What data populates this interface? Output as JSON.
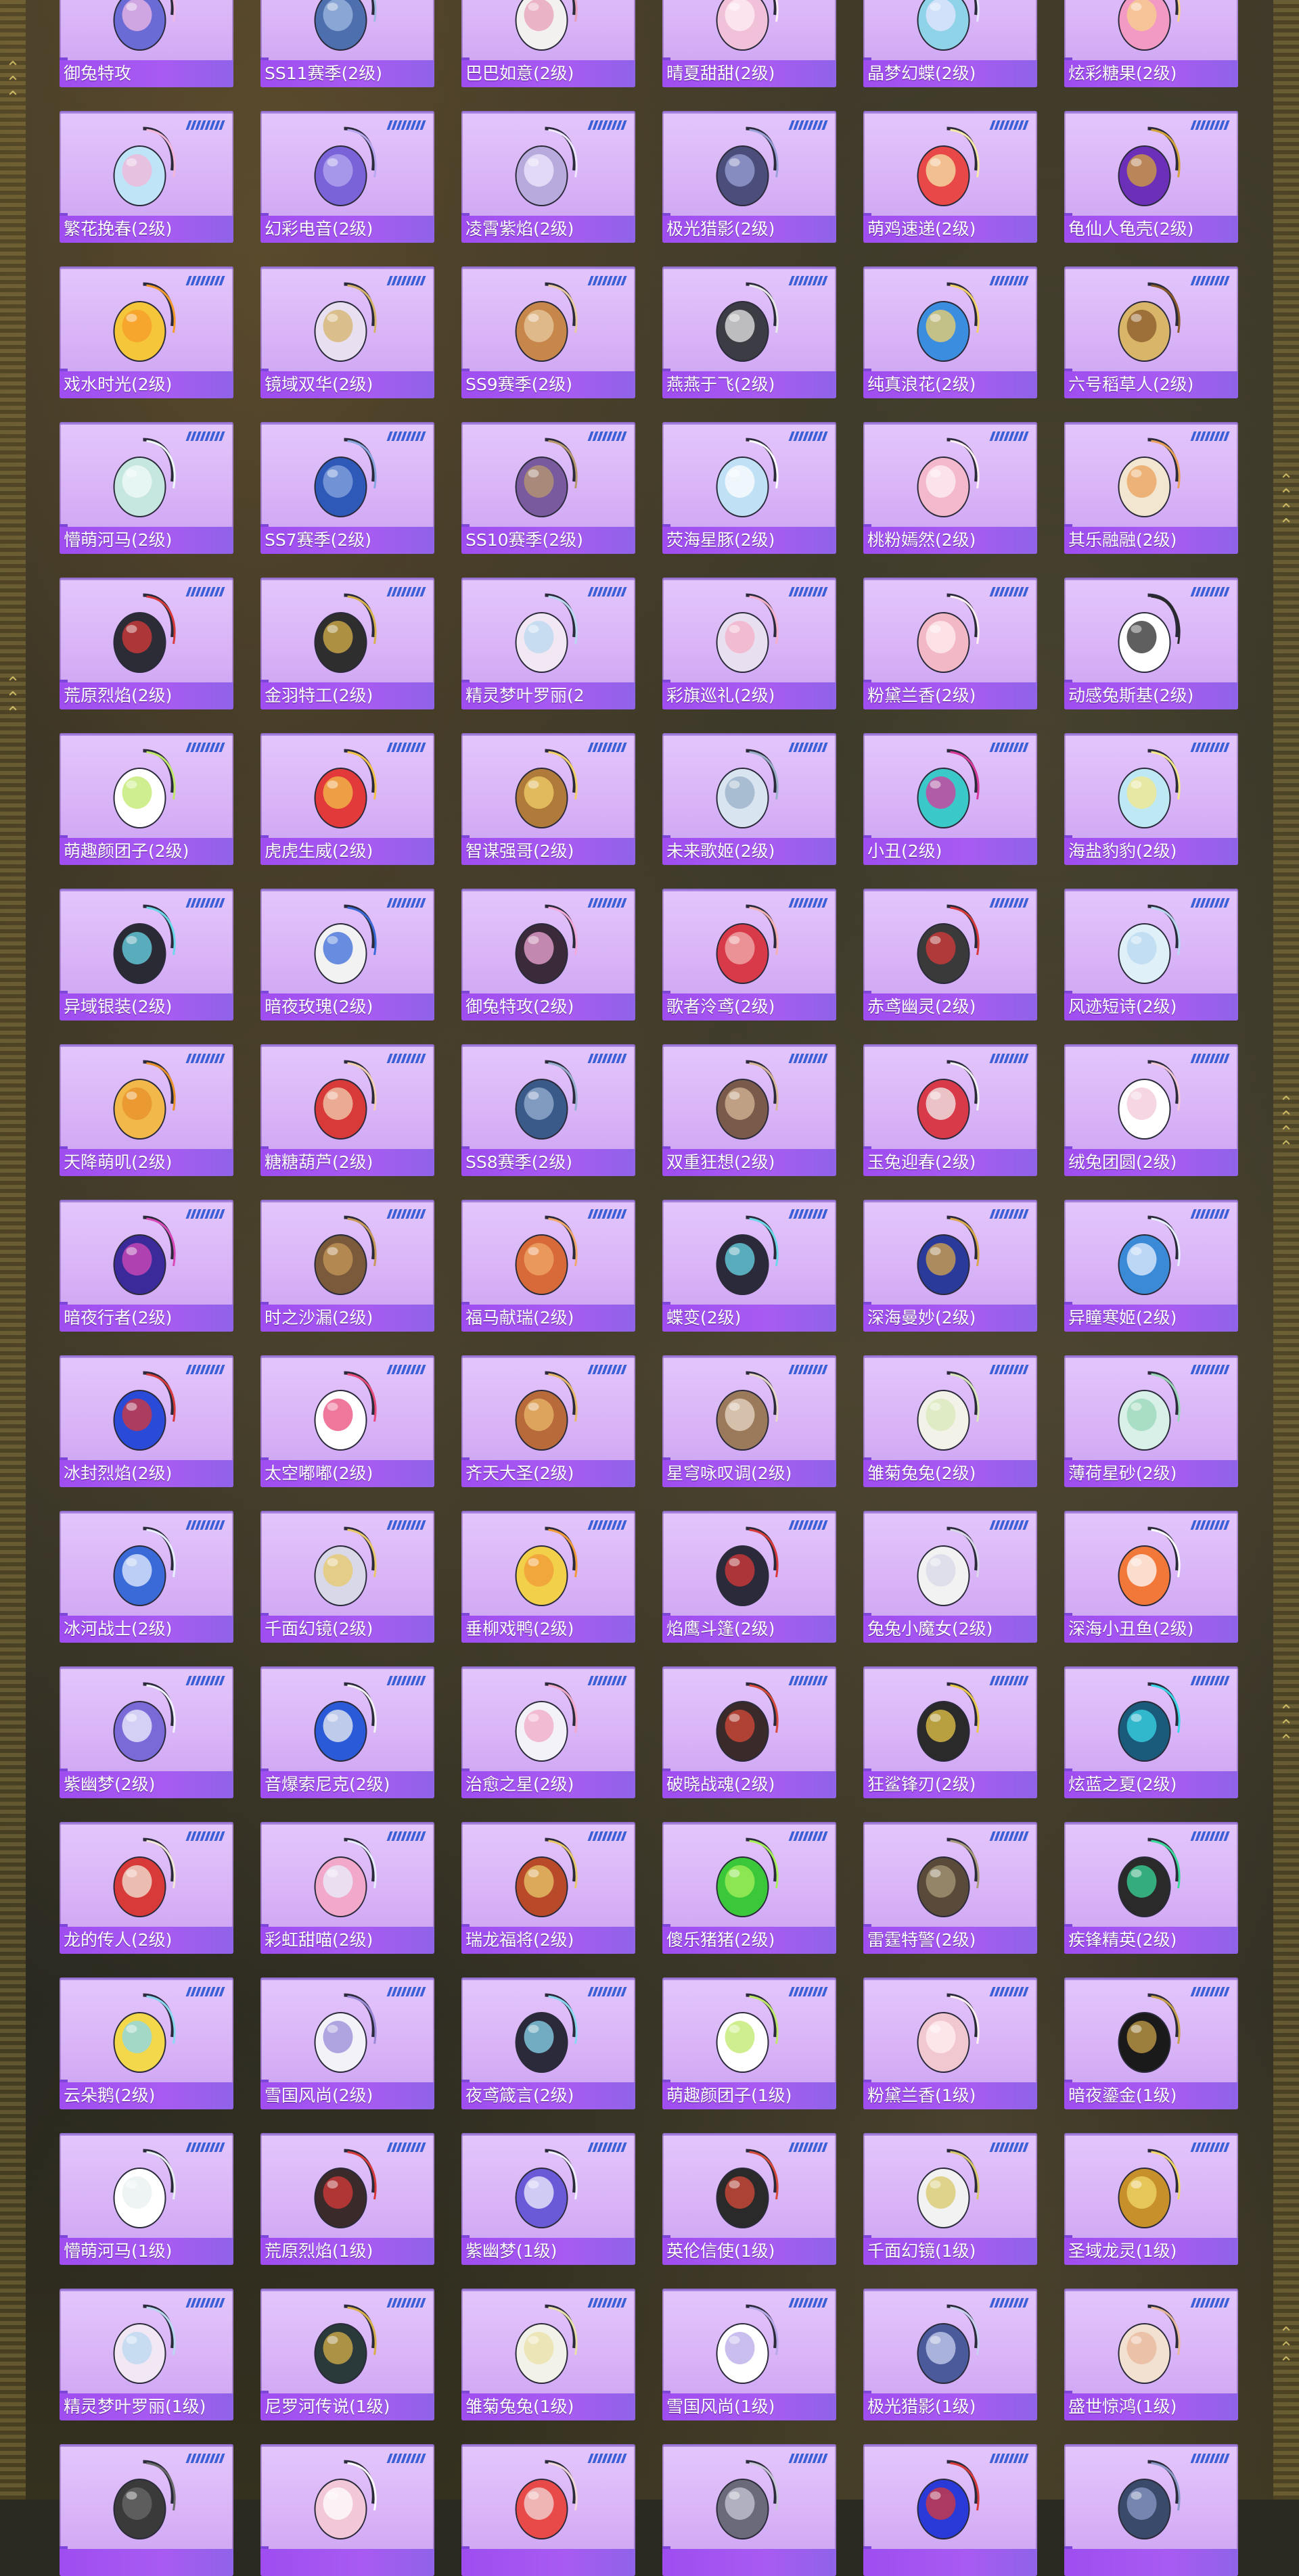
{
  "colors": {
    "card_top": "#e4c6fb",
    "card_bottom": "#caa0f2",
    "label_bar": "#9f4df0",
    "label_text": "#ffffff",
    "tick_marks": "#3a5fd6",
    "frame_gold": "#8c7a3c"
  },
  "items": [
    {
      "name": "御兔特攻",
      "icon": "helmet-backpack-icon",
      "c1": "#6b6bd6",
      "c2": "#f0b8e6"
    },
    {
      "name": "SS11赛季(2级)",
      "icon": "season-backpack-icon",
      "c1": "#4e6fae",
      "c2": "#9fb8e0"
    },
    {
      "name": "巴巴如意(2级)",
      "icon": "plush-backpack-icon",
      "c1": "#f3f0f0",
      "c2": "#e7a0b8"
    },
    {
      "name": "晴夏甜甜(2级)",
      "icon": "shell-backpack-icon",
      "c1": "#f1c0d9",
      "c2": "#fff0f6"
    },
    {
      "name": "晶梦幻蝶(2级)",
      "icon": "butterfly-backpack-icon",
      "c1": "#8fd3e8",
      "c2": "#e6e6ff"
    },
    {
      "name": "炫彩糖果(2级)",
      "icon": "candy-backpack-icon",
      "c1": "#f29ac4",
      "c2": "#f7d18a"
    },
    {
      "name": "繁花挽春(2级)",
      "icon": "bottle-backpack-icon",
      "c1": "#bfe3f7",
      "c2": "#f4b6d8"
    },
    {
      "name": "幻彩电音(2级)",
      "icon": "robot-backpack-icon",
      "c1": "#7a63d8",
      "c2": "#b7a8f0"
    },
    {
      "name": "凌霄紫焰(2级)",
      "icon": "mask-backpack-icon",
      "c1": "#b8aadc",
      "c2": "#f0e8ff"
    },
    {
      "name": "极光猎影(2级)",
      "icon": "armor-backpack-icon",
      "c1": "#4b4e7a",
      "c2": "#9aa0d8"
    },
    {
      "name": "萌鸡速递(2级)",
      "icon": "chick-backpack-icon",
      "c1": "#e84848",
      "c2": "#f6e8a8"
    },
    {
      "name": "龟仙人龟壳(2级)",
      "icon": "turtle-shell-backpack-icon",
      "c1": "#6b2fb8",
      "c2": "#d4a43a"
    },
    {
      "name": "戏水时光(2级)",
      "icon": "duck-backpack-icon",
      "c1": "#f6c63a",
      "c2": "#f59a2a"
    },
    {
      "name": "镜域双华(2级)",
      "icon": "heart-backpack-icon",
      "c1": "#e8e0f0",
      "c2": "#d6b36a"
    },
    {
      "name": "SS9赛季(2级)",
      "icon": "season-backpack-icon",
      "c1": "#c8874a",
      "c2": "#e8c9a0"
    },
    {
      "name": "燕燕于飞(2级)",
      "icon": "bird-backpack-icon",
      "c1": "#3c3c44",
      "c2": "#e8e8e8"
    },
    {
      "name": "纯真浪花(2级)",
      "icon": "drink-cup-backpack-icon",
      "c1": "#3b8de0",
      "c2": "#f2d16b"
    },
    {
      "name": "六号稻草人(2级)",
      "icon": "scarecrow-backpack-icon",
      "c1": "#d9b56a",
      "c2": "#8a5a2a"
    },
    {
      "name": "懵萌河马(2级)",
      "icon": "hippo-backpack-icon",
      "c1": "#c6e6e0",
      "c2": "#f0fbf8"
    },
    {
      "name": "SS7赛季(2级)",
      "icon": "season-backpack-icon",
      "c1": "#2f59b8",
      "c2": "#8aa6e0"
    },
    {
      "name": "SS10赛季(2级)",
      "icon": "season-backpack-icon",
      "c1": "#7a5a9e",
      "c2": "#b89a6e"
    },
    {
      "name": "荧海星豚(2级)",
      "icon": "dolphin-backpack-icon",
      "c1": "#bfe0f5",
      "c2": "#ffffff"
    },
    {
      "name": "桃粉嫣然(2级)",
      "icon": "bunny-backpack-icon",
      "c1": "#f4b8cc",
      "c2": "#fff0f4"
    },
    {
      "name": "其乐融融(2级)",
      "icon": "cupcake-backpack-icon",
      "c1": "#f2e6d0",
      "c2": "#e9a05a"
    },
    {
      "name": "荒原烈焰(2级)",
      "icon": "flame-mask-backpack-icon",
      "c1": "#2c2c36",
      "c2": "#d83a3a"
    },
    {
      "name": "金羽特工(2级)",
      "icon": "tactical-backpack-icon",
      "c1": "#2e2e2e",
      "c2": "#d8b24a"
    },
    {
      "name": "精灵梦叶罗丽(2",
      "icon": "heart-bag-backpack-icon",
      "c1": "#f2e8f4",
      "c2": "#b8d8f0"
    },
    {
      "name": "彩旗巡礼(2级)",
      "icon": "bow-backpack-icon",
      "c1": "#e8e0f0",
      "c2": "#f4b0c8"
    },
    {
      "name": "粉黛兰香(2级)",
      "icon": "shell-backpack-icon",
      "c1": "#f2b8c6",
      "c2": "#fff0f2"
    },
    {
      "name": "动感兔斯基(2级)",
      "icon": "rabbit-backpack-icon",
      "c1": "#ffffff",
      "c2": "#2a2a2a"
    },
    {
      "name": "萌趣颜团子(2级)",
      "icon": "bunny-backpack-icon",
      "c1": "#ffffff",
      "c2": "#bfe86a"
    },
    {
      "name": "虎虎生威(2级)",
      "icon": "tiger-backpack-icon",
      "c1": "#e23a3a",
      "c2": "#f2c24a"
    },
    {
      "name": "智谋强哥(2级)",
      "icon": "bear-backpack-icon",
      "c1": "#b07a3a",
      "c2": "#f2d06a"
    },
    {
      "name": "未来歌姬(2级)",
      "icon": "idol-backpack-icon",
      "c1": "#d8e4f0",
      "c2": "#9ab0c8"
    },
    {
      "name": "小丑(2级)",
      "icon": "clown-backpack-icon",
      "c1": "#3ac8c8",
      "c2": "#d83a9a"
    },
    {
      "name": "海盐豹豹(2级)",
      "icon": "seal-backpack-icon",
      "c1": "#bfe8f5",
      "c2": "#f5e88a"
    },
    {
      "name": "异域银装(2级)",
      "icon": "crate-backpack-icon",
      "c1": "#2a2a34",
      "c2": "#6ad8e8"
    },
    {
      "name": "暗夜玫瑰(2级)",
      "icon": "plush-bunny-backpack-icon",
      "c1": "#f2f2f2",
      "c2": "#3a6ad8"
    },
    {
      "name": "御兔特攻(2级)",
      "icon": "helmet-backpack-icon",
      "c1": "#3a2a3a",
      "c2": "#f2a8d8"
    },
    {
      "name": "歌者泠鸢(2级)",
      "icon": "lantern-backpack-icon",
      "c1": "#d83a4a",
      "c2": "#f2b0b0"
    },
    {
      "name": "赤鸢幽灵(2级)",
      "icon": "tactical-backpack-icon",
      "c1": "#3a3a3a",
      "c2": "#d83a3a"
    },
    {
      "name": "风迹短诗(2级)",
      "icon": "cassette-backpack-icon",
      "c1": "#e0f0f8",
      "c2": "#b8d8f0"
    },
    {
      "name": "天降萌叽(2级)",
      "icon": "mech-backpack-icon",
      "c1": "#f2b84a",
      "c2": "#e8902a"
    },
    {
      "name": "糖糖葫芦(2级)",
      "icon": "candied-haws-backpack-icon",
      "c1": "#d83a3a",
      "c2": "#f2d0b0"
    },
    {
      "name": "SS8赛季(2级)",
      "icon": "season-backpack-icon",
      "c1": "#3a5a8a",
      "c2": "#9ab0d0"
    },
    {
      "name": "双重狂想(2级)",
      "icon": "creature-backpack-icon",
      "c1": "#7a5a4a",
      "c2": "#d8b898"
    },
    {
      "name": "玉兔迎春(2级)",
      "icon": "rabbit-backpack-icon",
      "c1": "#d83a4a",
      "c2": "#f2f2f2"
    },
    {
      "name": "绒兔团圆(2级)",
      "icon": "bunny-backpack-icon",
      "c1": "#ffffff",
      "c2": "#f2c8d8"
    },
    {
      "name": "暗夜行者(2级)",
      "icon": "cube-backpack-icon",
      "c1": "#3a2a9a",
      "c2": "#d84ab8"
    },
    {
      "name": "时之沙漏(2级)",
      "icon": "steampunk-backpack-icon",
      "c1": "#7a5a3a",
      "c2": "#c89a5a"
    },
    {
      "name": "福马献瑞(2级)",
      "icon": "horse-backpack-icon",
      "c1": "#d86a3a",
      "c2": "#f2a86a"
    },
    {
      "name": "蝶变(2级)",
      "icon": "butterfly-backpack-icon",
      "c1": "#2a2a3a",
      "c2": "#6ad8e8"
    },
    {
      "name": "深海曼妙(2级)",
      "icon": "jar-backpack-icon",
      "c1": "#2a3a9a",
      "c2": "#d8a84a"
    },
    {
      "name": "异瞳寒姬(2级)",
      "icon": "cat-backpack-icon",
      "c1": "#3a8ad8",
      "c2": "#e8f0ff"
    },
    {
      "name": "冰封烈焰(2级)",
      "icon": "armored-backpack-icon",
      "c1": "#2a4ad8",
      "c2": "#d83a3a"
    },
    {
      "name": "太空嘟嘟(2级)",
      "icon": "space-pet-backpack-icon",
      "c1": "#ffffff",
      "c2": "#e84a7a"
    },
    {
      "name": "齐天大圣(2级)",
      "icon": "monkey-king-backpack-icon",
      "c1": "#b86a3a",
      "c2": "#e8b86a"
    },
    {
      "name": "星穹咏叹调(2级)",
      "icon": "rabbit-backpack-icon",
      "c1": "#9a7a5a",
      "c2": "#e8d8c8"
    },
    {
      "name": "雏菊兔兔(2级)",
      "icon": "bunny-backpack-icon",
      "c1": "#f2f2e8",
      "c2": "#d8e8b8"
    },
    {
      "name": "薄荷星砂(2级)",
      "icon": "bottle-backpack-icon",
      "c1": "#d8f0e8",
      "c2": "#9ad8b8"
    },
    {
      "name": "冰河战士(2级)",
      "icon": "armored-backpack-icon",
      "c1": "#3a6ad8",
      "c2": "#e8f0ff"
    },
    {
      "name": "千面幻镜(2级)",
      "icon": "mirror-backpack-icon",
      "c1": "#d8d8e8",
      "c2": "#e8c86a"
    },
    {
      "name": "垂柳戏鸭(2级)",
      "icon": "duck-backpack-icon",
      "c1": "#f2d04a",
      "c2": "#f29a3a"
    },
    {
      "name": "焰鹰斗篷(2级)",
      "icon": "cloak-backpack-icon",
      "c1": "#2a2a3a",
      "c2": "#d83a3a"
    },
    {
      "name": "兔兔小魔女(2级)",
      "icon": "bunny-backpack-icon",
      "c1": "#f2f2f2",
      "c2": "#d8d8e8"
    },
    {
      "name": "深海小丑鱼(2级)",
      "icon": "clownfish-backpack-icon",
      "c1": "#f2783a",
      "c2": "#ffffff"
    },
    {
      "name": "紫幽梦(2级)",
      "icon": "orb-backpack-icon",
      "c1": "#7a6ad8",
      "c2": "#f2f2ff"
    },
    {
      "name": "音爆索尼克(2级)",
      "icon": "hedgehog-backpack-icon",
      "c1": "#2a5ad8",
      "c2": "#f2f2f2"
    },
    {
      "name": "治愈之星(2级)",
      "icon": "medical-backpack-icon",
      "c1": "#f2f2f8",
      "c2": "#f2a8c8"
    },
    {
      "name": "破晓战魂(2级)",
      "icon": "warrior-backpack-icon",
      "c1": "#3a2a2a",
      "c2": "#d84a3a"
    },
    {
      "name": "狂鲨锋刃(2级)",
      "icon": "shark-backpack-icon",
      "c1": "#2a2a2a",
      "c2": "#e8c84a"
    },
    {
      "name": "炫蓝之夏(2级)",
      "icon": "tactical-backpack-icon",
      "c1": "#1a5a7a",
      "c2": "#3ad8e8"
    },
    {
      "name": "龙的传人(2级)",
      "icon": "dragon-backpack-icon",
      "c1": "#d83a3a",
      "c2": "#f2e8d8"
    },
    {
      "name": "彩虹甜喵(2级)",
      "icon": "cat-backpack-icon",
      "c1": "#f2a8c8",
      "c2": "#e8f0ff"
    },
    {
      "name": "瑞龙福将(2级)",
      "icon": "dragon-armor-backpack-icon",
      "c1": "#b84a2a",
      "c2": "#e8c86a"
    },
    {
      "name": "傻乐猪猪(2级)",
      "icon": "pig-backpack-icon",
      "c1": "#3ac83a",
      "c2": "#a8f05a"
    },
    {
      "name": "雷霆特警(2级)",
      "icon": "police-backpack-icon",
      "c1": "#5a4a3a",
      "c2": "#a89a7a"
    },
    {
      "name": "疾锋精英(2级)",
      "icon": "elite-backpack-icon",
      "c1": "#2a2a2a",
      "c2": "#3ad89a"
    },
    {
      "name": "云朵鹅(2级)",
      "icon": "goose-backpack-icon",
      "c1": "#f2d84a",
      "c2": "#8ad8f0"
    },
    {
      "name": "雪国风尚(2级)",
      "icon": "snow-backpack-icon",
      "c1": "#f2f2f8",
      "c2": "#9a8ad8"
    },
    {
      "name": "夜鸢箴言(2级)",
      "icon": "kite-backpack-icon",
      "c1": "#2a2a3a",
      "c2": "#8ad8f0"
    },
    {
      "name": "萌趣颜团子(1级)",
      "icon": "bunny-backpack-icon",
      "c1": "#ffffff",
      "c2": "#bfe86a"
    },
    {
      "name": "粉黛兰香(1级)",
      "icon": "bunny-backpack-icon",
      "c1": "#f2c8d0",
      "c2": "#fff0f2"
    },
    {
      "name": "暗夜鎏金(1级)",
      "icon": "dark-gold-backpack-icon",
      "c1": "#1a1a1a",
      "c2": "#c8a04a"
    },
    {
      "name": "懵萌河马(1级)",
      "icon": "hippo-backpack-icon",
      "c1": "#ffffff",
      "c2": "#e8f0f0"
    },
    {
      "name": "荒原烈焰(1级)",
      "icon": "flame-mask-backpack-icon",
      "c1": "#3a2a2a",
      "c2": "#d83a3a"
    },
    {
      "name": "紫幽梦(1级)",
      "icon": "orb-backpack-icon",
      "c1": "#6a5ad8",
      "c2": "#f2f2ff"
    },
    {
      "name": "英伦信使(1级)",
      "icon": "messenger-backpack-icon",
      "c1": "#2a2a2a",
      "c2": "#d84a3a"
    },
    {
      "name": "千面幻镜(1级)",
      "icon": "mirror-backpack-icon",
      "c1": "#f2f2f2",
      "c2": "#d8c86a"
    },
    {
      "name": "圣域龙灵(1级)",
      "icon": "dragon-emblem-backpack-icon",
      "c1": "#c8902a",
      "c2": "#f2d86a"
    },
    {
      "name": "精灵梦叶罗丽(1级)",
      "icon": "bunny-backpack-icon",
      "c1": "#f2e8f4",
      "c2": "#b8d8f0"
    },
    {
      "name": "尼罗河传说(1级)",
      "icon": "pharaoh-backpack-icon",
      "c1": "#2a3a3a",
      "c2": "#d8b04a"
    },
    {
      "name": "雏菊兔兔(1级)",
      "icon": "bunny-backpack-icon",
      "c1": "#f2f2e8",
      "c2": "#e8e0a8"
    },
    {
      "name": "雪国风尚(1级)",
      "icon": "snow-backpack-icon",
      "c1": "#ffffff",
      "c2": "#b8a8e8"
    },
    {
      "name": "极光猎影(1级)",
      "icon": "armor-backpack-icon",
      "c1": "#4a5a9a",
      "c2": "#c8d0f0"
    },
    {
      "name": "盛世惊鸿(1级)",
      "icon": "shell-backpack-icon",
      "c1": "#f2e0d0",
      "c2": "#e8b89a"
    },
    {
      "name": "",
      "icon": "tactical-backpack-icon",
      "c1": "#3a3a3a",
      "c2": "#6a6a6a"
    },
    {
      "name": "",
      "icon": "bunny-backpack-icon",
      "c1": "#f2c8d8",
      "c2": "#ffffff"
    },
    {
      "name": "",
      "icon": "rabbit-backpack-icon",
      "c1": "#e84a4a",
      "c2": "#f2d8d8"
    },
    {
      "name": "",
      "icon": "armor-backpack-icon",
      "c1": "#6a6a7a",
      "c2": "#c8c8d8"
    },
    {
      "name": "",
      "icon": "armored-backpack-icon",
      "c1": "#2a3ad8",
      "c2": "#d83a3a"
    },
    {
      "name": "",
      "icon": "tactical-backpack-icon",
      "c1": "#3a4a6a",
      "c2": "#8a9ac8"
    }
  ]
}
